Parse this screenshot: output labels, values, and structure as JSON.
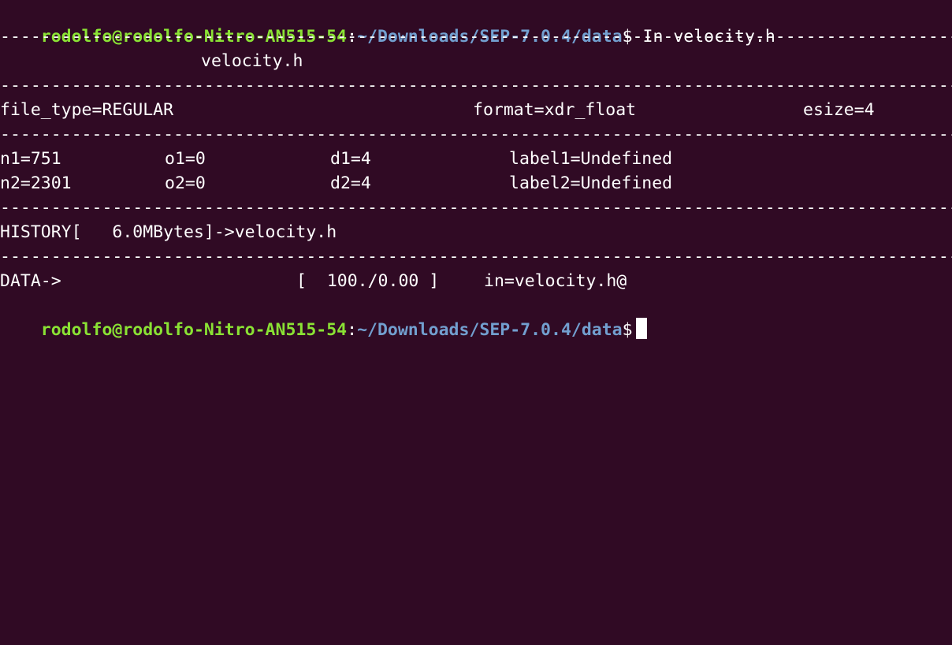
{
  "prompt": {
    "user_host": "rodolfo@rodolfo-Nitro-AN515-54",
    "colon": ":",
    "path": "~/Downloads/SEP-7.0.4/data",
    "dollar": "$"
  },
  "command": " In velocity.h",
  "separator": "-----------------------------------------------------------------------------------------------",
  "header_title": "velocity.h",
  "file_info": {
    "file_type": "file_type=REGULAR",
    "format": "format=xdr_float",
    "esize": "esize=4"
  },
  "axes": [
    {
      "n": "n1=751",
      "o": "o1=0",
      "d": "d1=4",
      "label": "label1=Undefined"
    },
    {
      "n": "n2=2301",
      "o": "o2=0",
      "d": "d2=4",
      "label": "label2=Undefined"
    }
  ],
  "history": "HISTORY[   6.0MBytes]->velocity.h",
  "data_line": {
    "label": "DATA->",
    "range": "[  100./0.00 ]",
    "in": "in=velocity.h@"
  },
  "colors": {
    "background": "#300a24",
    "user_host": "#8ae234",
    "path": "#729fcf",
    "text": "#ffffff"
  }
}
